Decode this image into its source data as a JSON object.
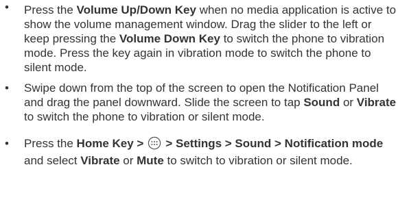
{
  "items": [
    {
      "bullet": "•",
      "t1": "Press the ",
      "b1": "Volume Up/Down Key",
      "t2": " when no media application is active to show the volume management window. Drag the slider to the left or keep pressing the ",
      "b2": "Volume Down Key",
      "t3": " to switch the phone to vibration mode. Press the key again in vibration mode to switch the phone to silent mode."
    },
    {
      "bullet": "•",
      "t1": "Swipe down from the top of the screen to open the Notification Panel and drag the panel downward. Slide the screen to tap ",
      "b1": "Sound",
      "t2": " or ",
      "b2": "Vibrate",
      "t3": " to switch the phone to vibration or silent mode."
    },
    {
      "bullet": "•",
      "t1": "Press the ",
      "b1": "Home Key >",
      "icon": "apps-icon",
      "b2": "> Settings > Sound > Notification mode",
      "t2": " and select ",
      "b3": "Vibrate",
      "t3": " or ",
      "b4": "Mute",
      "t4": " to switch to vibration or silent mode."
    }
  ]
}
